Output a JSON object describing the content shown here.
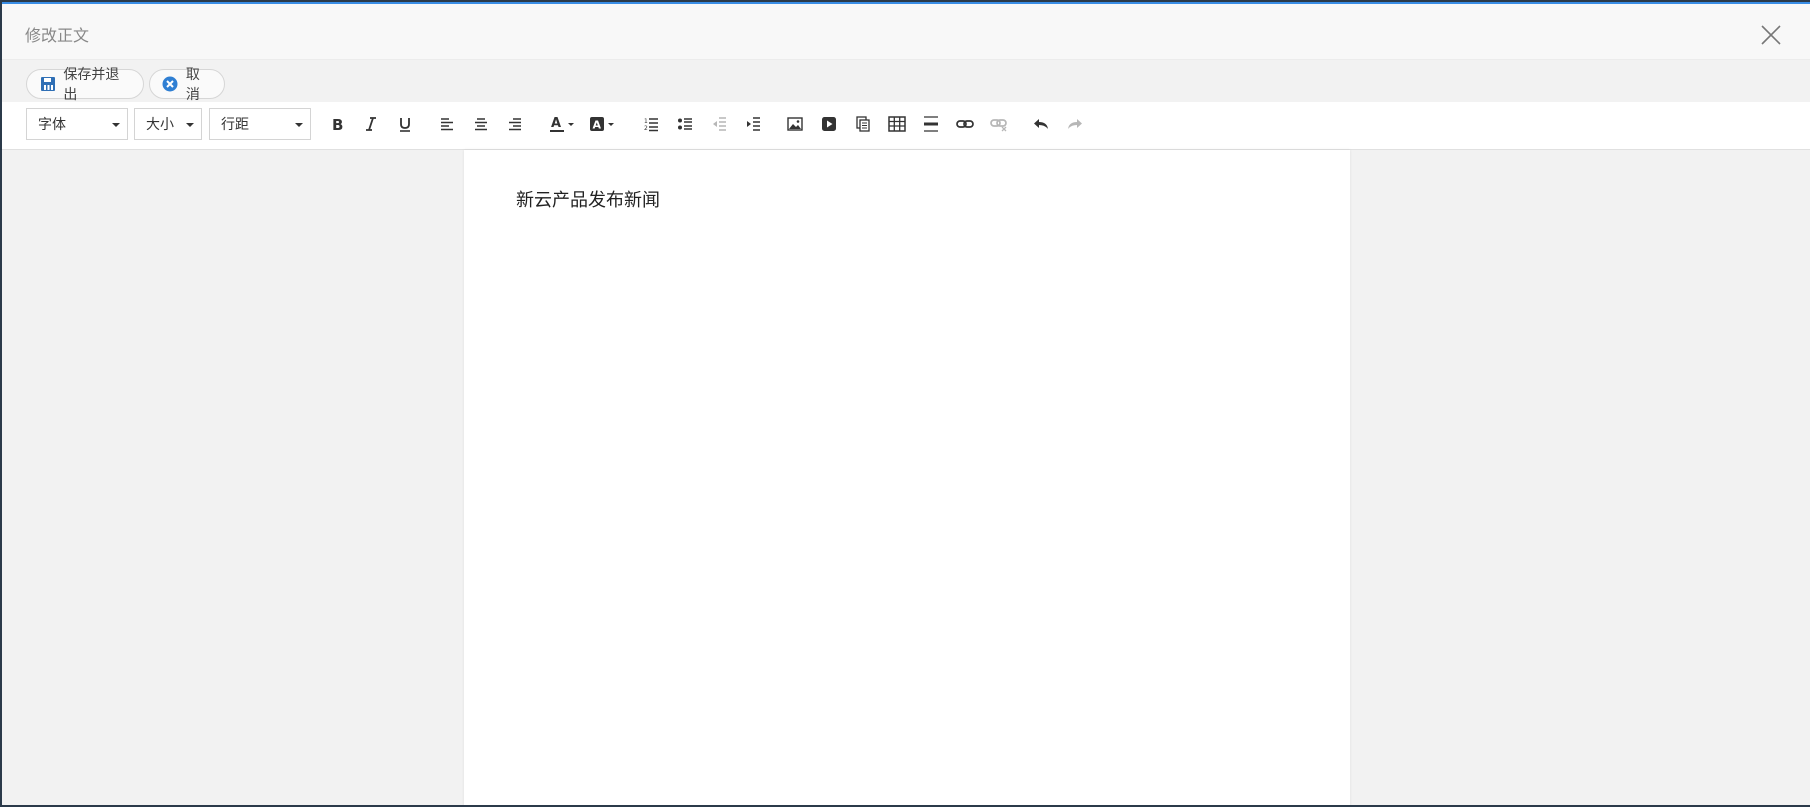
{
  "dialog": {
    "title": "修改正文"
  },
  "actions": {
    "save_label": "保存并退出",
    "cancel_label": "取消"
  },
  "toolbar": {
    "font_label": "字体",
    "size_label": "大小",
    "line_spacing_label": "行距"
  },
  "document": {
    "content": "新云产品发布新闻"
  },
  "colors": {
    "accent": "#3a8ee6",
    "save_icon": "#2f6fb5",
    "cancel_icon": "#2f7fd3"
  }
}
